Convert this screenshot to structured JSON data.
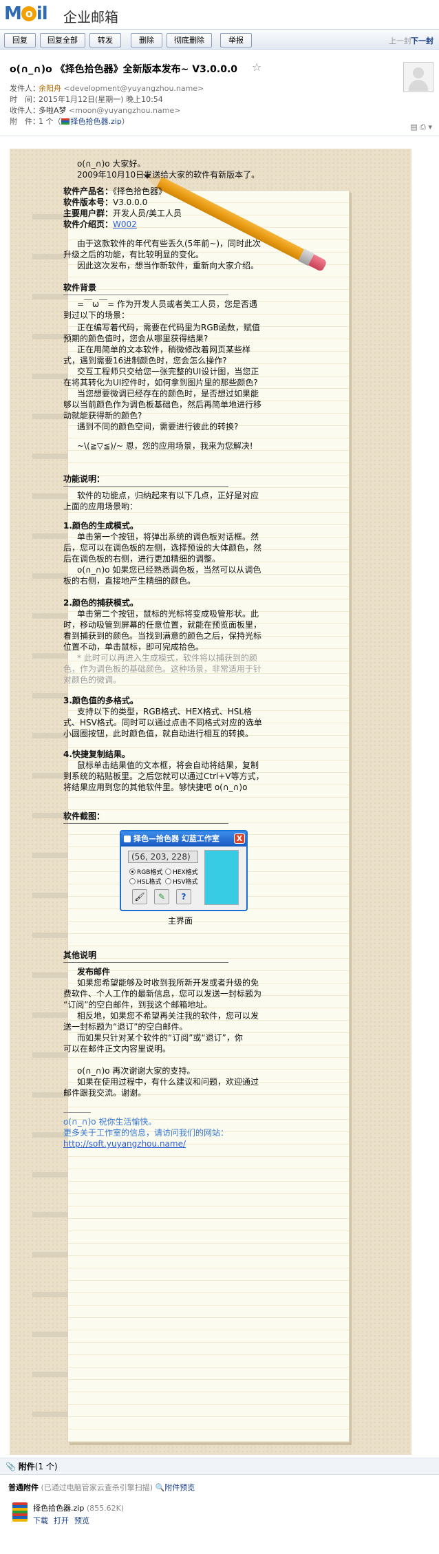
{
  "app": {
    "logo": "MOil",
    "logo_sub": "企业邮箱"
  },
  "toolbar": {
    "buttons": [
      "回复",
      "回复全部",
      "转发",
      "删除",
      "彻底删除",
      "举报"
    ],
    "prev": "上一封",
    "next": "下一封"
  },
  "mail": {
    "subject": "o(∩_∩)o 《择色拾色器》全新版本发布~ V3.0.0.0",
    "from_label": "发件人：",
    "from_name": "余阳舟",
    "from_addr": "<development@yuyangzhou.name>",
    "time_label": "时　间：",
    "time": "2015年1月12日(星期一) 晚上10:54",
    "to_label": "收件人：",
    "to_name": "多啦A梦",
    "to_addr": "<moon@yuyangzhou.name>",
    "att_label": "附　件：",
    "att_count": "1 个（",
    "att_file": "择色拾色器.zip",
    "att_close": "）"
  },
  "letter": {
    "greet1": "o(∩_∩)o  大家好。",
    "greet2": "2009年10月10日发送给大家的软件有新版本了。",
    "info": [
      {
        "k": "软件产品名：",
        "v": "《择色拾色器》"
      },
      {
        "k": "软件版本号：",
        "v": "V3.0.0.0"
      },
      {
        "k": "主要用户群：",
        "v": "开发人员/美工人员"
      },
      {
        "k": "软件介绍页：",
        "v": "W002"
      }
    ],
    "intro": [
      "由于这款软件的年代有些丢久(5年前~)，同时此次",
      "升级之后的功能，有比较明显的变化。",
      "因此这次发布，想当作新软件，重新向大家介绍。"
    ],
    "bg_title": "软件背景",
    "bg": [
      "=￣ω￣=  作为开发人员或者美工人员，您是否遇",
      "到过以下的场景：",
      "正在编写着代码，需要在代码里为RGB函数，赋值",
      "预期的颜色值时，您会从哪里获得结果?",
      "正在用简单的文本软件，稍微修改着网页某些样",
      "式，遇到需要16进制颜色时，您会怎么操作?",
      "交互工程师只交给您一张完整的UI设计图，当您正",
      "在将其转化为UI控件时，如何拿到图片里的那些颜色?",
      "当您想要微调已经存在的颜色时，是否想过如果能",
      "够以当前颜色作为调色板基础色，然后再简单地进行移",
      "动就能获得新的颜色?",
      "遇到不同的颜色空间，需要进行彼此的转换?",
      "~\\(≧▽≦)/~ 恩，您的应用场景，我来为您解决!"
    ],
    "func_title": "功能说明：",
    "func_intro": [
      "软件的功能点，归纳起来有以下几点，正好是对应",
      "上面的应用场景哟："
    ],
    "f1_title": "1.颜色的生成模式。",
    "f1": [
      "单击第一个按钮，将弹出系统的调色板对话框。然",
      "后，您可以在调色板的左侧，选择预设的大体颜色，然",
      "后在调色板的右侧，进行更加精细的调整。",
      "o(∩_∩)o 如果您已经熟悉调色板，当然可以从调色",
      "板的右侧，直接地产生精细的颜色。"
    ],
    "f2_title": "2.颜色的捕获模式。",
    "f2": [
      "单击第二个按钮，鼠标的光标将变成吸管形状。此",
      "时，移动吸管到屏幕的任意位置，就能在预览面板里，",
      "看到捕获到的颜色。当找到满意的颜色之后，保持光标",
      "位置不动，单击鼠标，即可完成拾色。",
      "* 此时可以再进入生成模式，软件将以捕获到的颜",
      "色，作为调色板的基础颜色。这种场景，非常适用于针",
      "对颜色的微调。"
    ],
    "f3_title": "3.颜色值的多格式。",
    "f3": [
      "支持以下的类型，RGB格式、HEX格式、HSL格",
      "式、HSV格式。同时可以通过点击不同格式对应的选单",
      "小圆圈按钮，此时颜色值，就自动进行相互的转换。"
    ],
    "f4_title": "4.快捷复制结果。",
    "f4": [
      "鼠标单击结果值的文本框，将会自动将结果，复制",
      "到系统的粘贴板里。之后您就可以通过Ctrl+V等方式，",
      "将结果应用到您的其他软件里。够快捷吧  o(∩_∩)o"
    ],
    "shot_title": "软件截图：",
    "app_win": {
      "title": "择色—拾色器    幻蓝工作室",
      "close": "X",
      "value": "(56, 203, 228)",
      "r1": "RGB格式",
      "r2": "HEX格式",
      "r3": "HSL格式",
      "r4": "HSV格式",
      "caption": "主界面",
      "swatch": "#38cbe4"
    },
    "other_title": "其他说明",
    "pub_title": "发布邮件",
    "pub": [
      "如果您希望能够及时收到我所新开发或者升级的免",
      "费软件、个人工作的最新信息，您可以发送一封标题为",
      "“订阅”的空白邮件，到我这个邮箱地址。",
      "相反地，如果您不希望再关注我的软件，您可以发",
      "送一封标题为“退订”的空白邮件。",
      "而如果只针对某个软件的“订阅”或“退订”，你",
      "可以在邮件正文内容里说明。"
    ],
    "thanks": [
      "o(∩_∩)o 再次谢谢大家的支持。",
      "如果在使用过程中，有什么建议和问题，欢迎通过",
      "邮件跟我交流。谢谢。"
    ],
    "sign1": "o(∩_∩)o  祝你生活愉快。",
    "sign2": "更多关于工作室的信息，请访问我们的网站：",
    "sign3": "http://soft.yuyangzhou.name/"
  },
  "attachments": {
    "title": "附件",
    "count": "(1 个)",
    "normal": "普通附件",
    "scan": "(已通过电脑管家云查杀引擎扫描)",
    "preview_all": "附件预览",
    "file": "择色拾色器.zip",
    "size": "(855.62K)",
    "actions": [
      "下载",
      "打开",
      "预览"
    ]
  }
}
